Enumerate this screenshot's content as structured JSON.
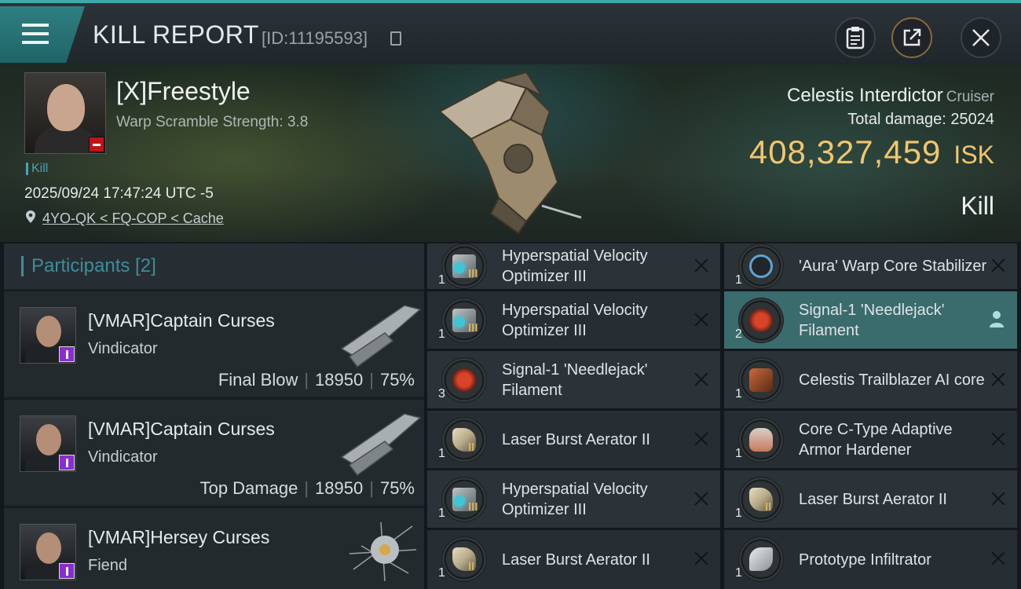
{
  "header": {
    "title": "KILL REPORT",
    "report_id": "[ID:11195593]"
  },
  "victim": {
    "name": "[X]Freestyle",
    "scramble": "Warp Scramble Strength: 3.8",
    "tag": "Kill",
    "datetime": "2025/09/24 17:47:24 UTC -5",
    "location": "4YO-QK < FQ-COP < Cache"
  },
  "ship": {
    "name": "Celestis Interdictor",
    "class": "Cruiser",
    "total_damage": "Total damage:  25024",
    "isk_value": "408,327,459",
    "isk_unit": "ISK",
    "result": "Kill"
  },
  "participants": {
    "header": "Participants [2]",
    "rows": [
      {
        "name": "[VMAR]Captain Curses",
        "ship": "Vindicator",
        "role": "Final Blow",
        "damage": "18950",
        "percent": "75%"
      },
      {
        "name": "[VMAR]Captain Curses",
        "ship": "Vindicator",
        "role": "Top Damage",
        "damage": "18950",
        "percent": "75%"
      },
      {
        "name": "[VMAR]Hersey Curses",
        "ship": "Fiend",
        "role": "",
        "damage": "",
        "percent": ""
      }
    ]
  },
  "items_left": [
    {
      "name": "Hyperspatial Velocity Optimizer III",
      "qty": "1",
      "meta": "III",
      "icon": "rig-icon",
      "color": "#3fc6d6"
    },
    {
      "name": "Hyperspatial Velocity Optimizer III",
      "qty": "1",
      "meta": "III",
      "icon": "rig-icon",
      "color": "#3fc6d6"
    },
    {
      "name": "Signal-1 'Needlejack' Filament",
      "qty": "3",
      "meta": "",
      "icon": "filament-icon",
      "color": "#d8442a"
    },
    {
      "name": "Laser Burst Aerator II",
      "qty": "1",
      "meta": "II",
      "icon": "laser-rig-icon",
      "color": "#b8ac8a"
    },
    {
      "name": "Hyperspatial Velocity Optimizer III",
      "qty": "1",
      "meta": "III",
      "icon": "rig-icon",
      "color": "#3fc6d6"
    },
    {
      "name": "Laser Burst Aerator II",
      "qty": "1",
      "meta": "II",
      "icon": "laser-rig-icon",
      "color": "#b8ac8a"
    }
  ],
  "items_right": [
    {
      "name": "'Aura' Warp Core Stabilizer",
      "qty": "1",
      "meta": "",
      "icon": "warp-core-icon",
      "color": "#5fa3d8"
    },
    {
      "name": "Signal-1 'Needlejack' Filament",
      "qty": "2",
      "meta": "",
      "icon": "filament-icon",
      "color": "#d8442a"
    },
    {
      "name": "Celestis Trailblazer AI core",
      "qty": "1",
      "meta": "",
      "icon": "ai-core-icon",
      "color": "#c8693a"
    },
    {
      "name": "Core C-Type Adaptive Armor Hardener",
      "qty": "1",
      "meta": "",
      "icon": "armor-hardener-icon",
      "color": "#c9785a"
    },
    {
      "name": "Laser Burst Aerator II",
      "qty": "1",
      "meta": "II",
      "icon": "laser-rig-icon",
      "color": "#b8ac8a"
    },
    {
      "name": "Prototype  Infiltrator",
      "qty": "1",
      "meta": "",
      "icon": "drone-icon",
      "color": "#c8ccd0"
    }
  ]
}
